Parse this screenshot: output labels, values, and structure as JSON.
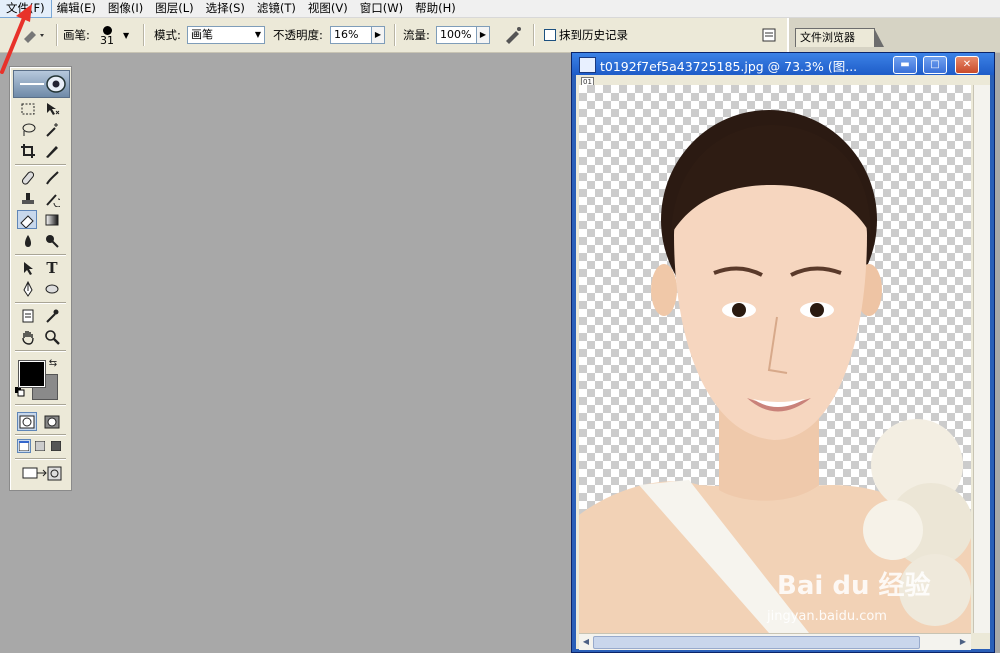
{
  "menu": {
    "items": [
      {
        "label": "文件(F)",
        "active": true
      },
      {
        "label": "编辑(E)"
      },
      {
        "label": "图像(I)"
      },
      {
        "label": "图层(L)"
      },
      {
        "label": "选择(S)"
      },
      {
        "label": "滤镜(T)"
      },
      {
        "label": "视图(V)"
      },
      {
        "label": "窗口(W)"
      },
      {
        "label": "帮助(H)"
      }
    ]
  },
  "options": {
    "brush_label": "画笔:",
    "brush_size": "31",
    "mode_label": "模式:",
    "mode_value": "画笔",
    "opacity_label": "不透明度:",
    "opacity_value": "16%",
    "flow_label": "流量:",
    "flow_value": "100%",
    "erase_history_label": "抹到历史记录",
    "erase_history_checked": false
  },
  "palette_well": {
    "tab_label": "文件浏览器"
  },
  "document": {
    "title": "t0192f7ef5a43725185.jpg @ 73.3% (图...",
    "zoom_tag": "01"
  },
  "watermark": {
    "brand": "Bai du 经验",
    "url": "jingyan.baidu.com"
  },
  "colors": {
    "foreground": "#000000",
    "background": "#8a8a8a",
    "arrow": "#e8322a",
    "title_bar": "#1e5cc8"
  }
}
